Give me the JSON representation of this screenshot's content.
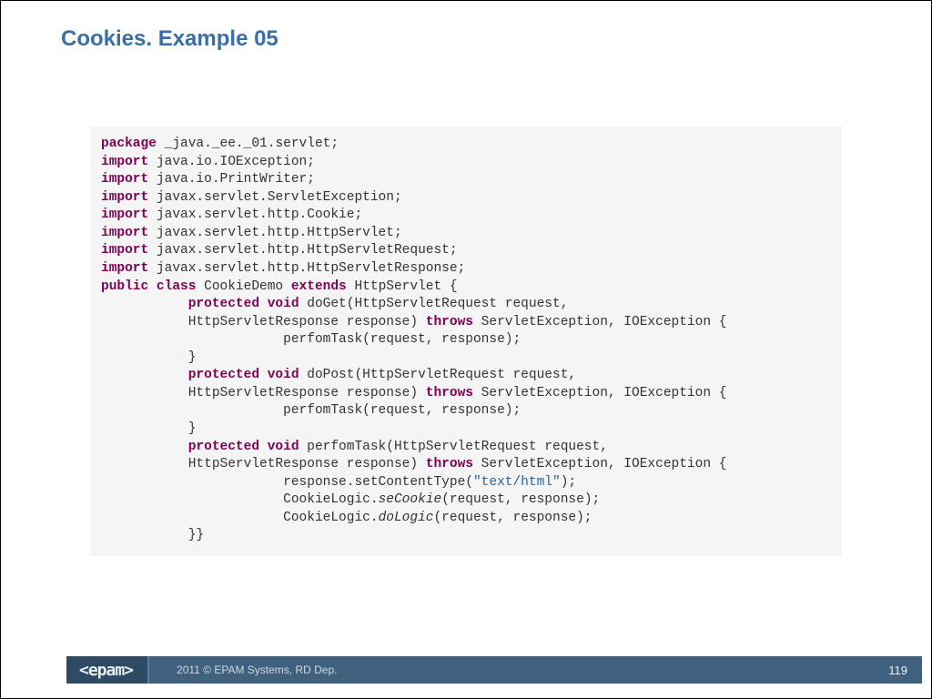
{
  "slide": {
    "title": "Cookies. Example 05",
    "footer": {
      "logo": "<epam>",
      "text": "2011 © EPAM Systems, RD Dep.",
      "page": "119"
    }
  },
  "code": {
    "lines": [
      [
        {
          "t": "package",
          "c": "kw"
        },
        {
          "t": " _java._ee._01.servlet;",
          "c": ""
        }
      ],
      [
        {
          "t": "import",
          "c": "kw"
        },
        {
          "t": " java.io.IOException;",
          "c": ""
        }
      ],
      [
        {
          "t": "import",
          "c": "kw"
        },
        {
          "t": " java.io.PrintWriter;",
          "c": ""
        }
      ],
      [
        {
          "t": "import",
          "c": "kw"
        },
        {
          "t": " javax.servlet.ServletException;",
          "c": ""
        }
      ],
      [
        {
          "t": "import",
          "c": "kw"
        },
        {
          "t": " javax.servlet.http.Cookie;",
          "c": ""
        }
      ],
      [
        {
          "t": "import",
          "c": "kw"
        },
        {
          "t": " javax.servlet.http.HttpServlet;",
          "c": ""
        }
      ],
      [
        {
          "t": "import",
          "c": "kw"
        },
        {
          "t": " javax.servlet.http.HttpServletRequest;",
          "c": ""
        }
      ],
      [
        {
          "t": "import",
          "c": "kw"
        },
        {
          "t": " javax.servlet.http.HttpServletResponse;",
          "c": ""
        }
      ],
      [
        {
          "t": "public class",
          "c": "kw"
        },
        {
          "t": " CookieDemo ",
          "c": ""
        },
        {
          "t": "extends",
          "c": "kw"
        },
        {
          "t": " HttpServlet {",
          "c": ""
        }
      ],
      [
        {
          "t": "           ",
          "c": ""
        },
        {
          "t": "protected void",
          "c": "kw"
        },
        {
          "t": " doGet(HttpServletRequest request,",
          "c": ""
        }
      ],
      [
        {
          "t": "           HttpServletResponse response) ",
          "c": ""
        },
        {
          "t": "throws",
          "c": "kw"
        },
        {
          "t": " ServletException, IOException {",
          "c": ""
        }
      ],
      [
        {
          "t": "                       perfomTask(request, response);",
          "c": ""
        }
      ],
      [
        {
          "t": "           }",
          "c": ""
        }
      ],
      [
        {
          "t": "           ",
          "c": ""
        },
        {
          "t": "protected void",
          "c": "kw"
        },
        {
          "t": " doPost(HttpServletRequest request,",
          "c": ""
        }
      ],
      [
        {
          "t": "           HttpServletResponse response) ",
          "c": ""
        },
        {
          "t": "throws",
          "c": "kw"
        },
        {
          "t": " ServletException, IOException {",
          "c": ""
        }
      ],
      [
        {
          "t": "                       perfomTask(request, response);",
          "c": ""
        }
      ],
      [
        {
          "t": "           }",
          "c": ""
        }
      ],
      [
        {
          "t": "           ",
          "c": ""
        },
        {
          "t": "protected void",
          "c": "kw"
        },
        {
          "t": " perfomTask(HttpServletRequest request,",
          "c": ""
        }
      ],
      [
        {
          "t": "           HttpServletResponse response) ",
          "c": ""
        },
        {
          "t": "throws",
          "c": "kw"
        },
        {
          "t": " ServletException, IOException {",
          "c": ""
        }
      ],
      [
        {
          "t": "                       response.setContentType(",
          "c": ""
        },
        {
          "t": "\"text/html\"",
          "c": "str"
        },
        {
          "t": ");",
          "c": ""
        }
      ],
      [
        {
          "t": "                       CookieLogic.",
          "c": ""
        },
        {
          "t": "seCookie",
          "c": "em1"
        },
        {
          "t": "(request, response);",
          "c": ""
        }
      ],
      [
        {
          "t": "                       CookieLogic.",
          "c": ""
        },
        {
          "t": "doLogic",
          "c": "em1"
        },
        {
          "t": "(request, response);",
          "c": ""
        }
      ],
      [
        {
          "t": "           }}",
          "c": ""
        }
      ]
    ]
  }
}
